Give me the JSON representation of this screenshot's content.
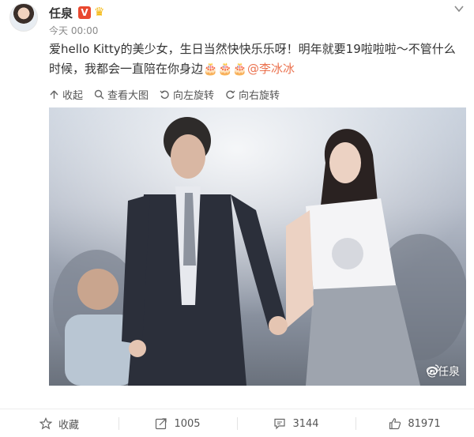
{
  "post": {
    "username": "任泉",
    "verified_badge": "V",
    "time": "今天 00:00",
    "text_before": "爱hello Kitty的美少女，生日当然快快乐乐呀！明年就要19啦啦啦～不管什么时候，我都会一直陪在你身边",
    "emojis": "🎂🎂🎂",
    "mention": "@李冰冰",
    "colors": {
      "mention": "#eb7350",
      "badge": "#e9482f"
    }
  },
  "toolbar": {
    "collapse": "收起",
    "view_large": "查看大图",
    "rotate_left": "向左旋转",
    "rotate_right": "向右旋转"
  },
  "photo": {
    "watermark": "@任泉",
    "watermark_icon": "weibo-logo-icon"
  },
  "footer": {
    "favorite": "收藏",
    "repost_count": "1005",
    "comment_count": "3144",
    "like_count": "81971"
  }
}
